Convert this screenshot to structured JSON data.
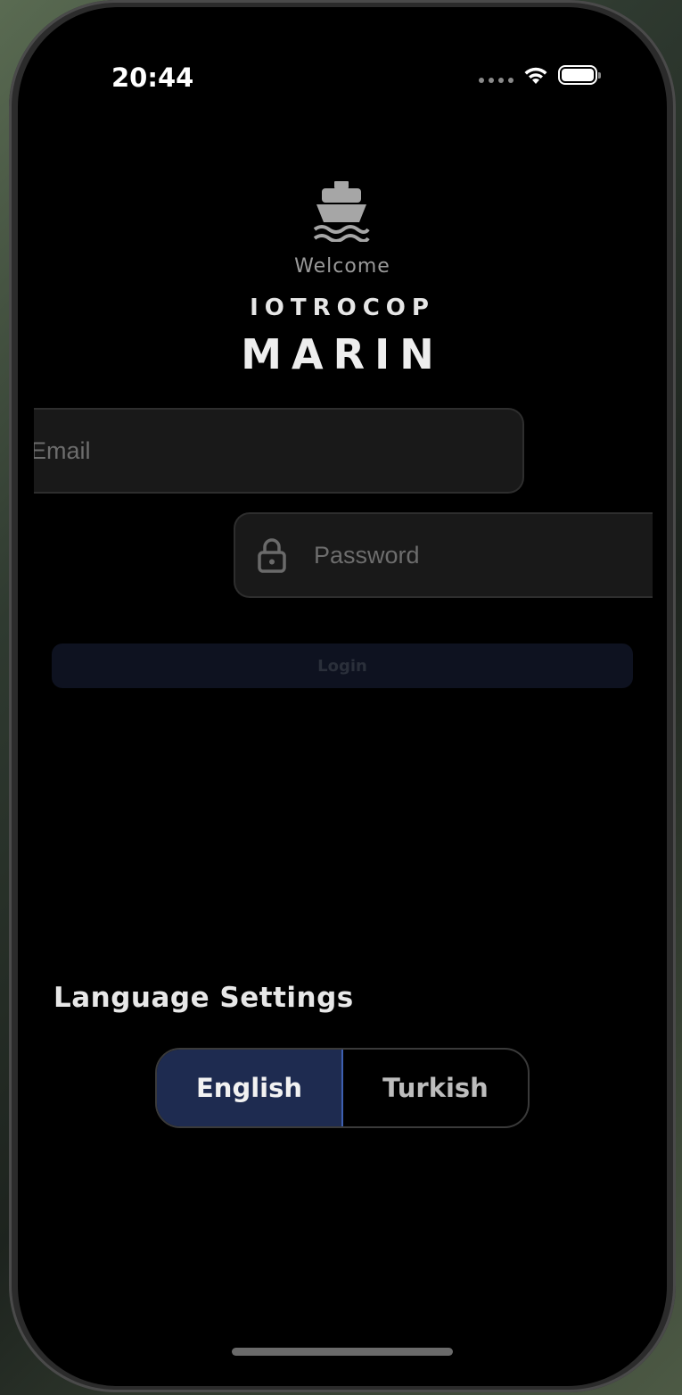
{
  "status_bar": {
    "time": "20:44"
  },
  "branding": {
    "welcome": "Welcome",
    "company": "IOTROCOP",
    "product": "MARIN",
    "logo_icon": "ship-icon"
  },
  "form": {
    "email_placeholder": "Email",
    "password_placeholder": "Password",
    "login_label": "Login"
  },
  "language": {
    "title": "Language Settings",
    "options": [
      "English",
      "Turkish"
    ],
    "selected": "English"
  },
  "colors": {
    "accent": "#3d5fb0",
    "selected_bg": "#1e2b50",
    "login_bg": "#0e1220"
  }
}
